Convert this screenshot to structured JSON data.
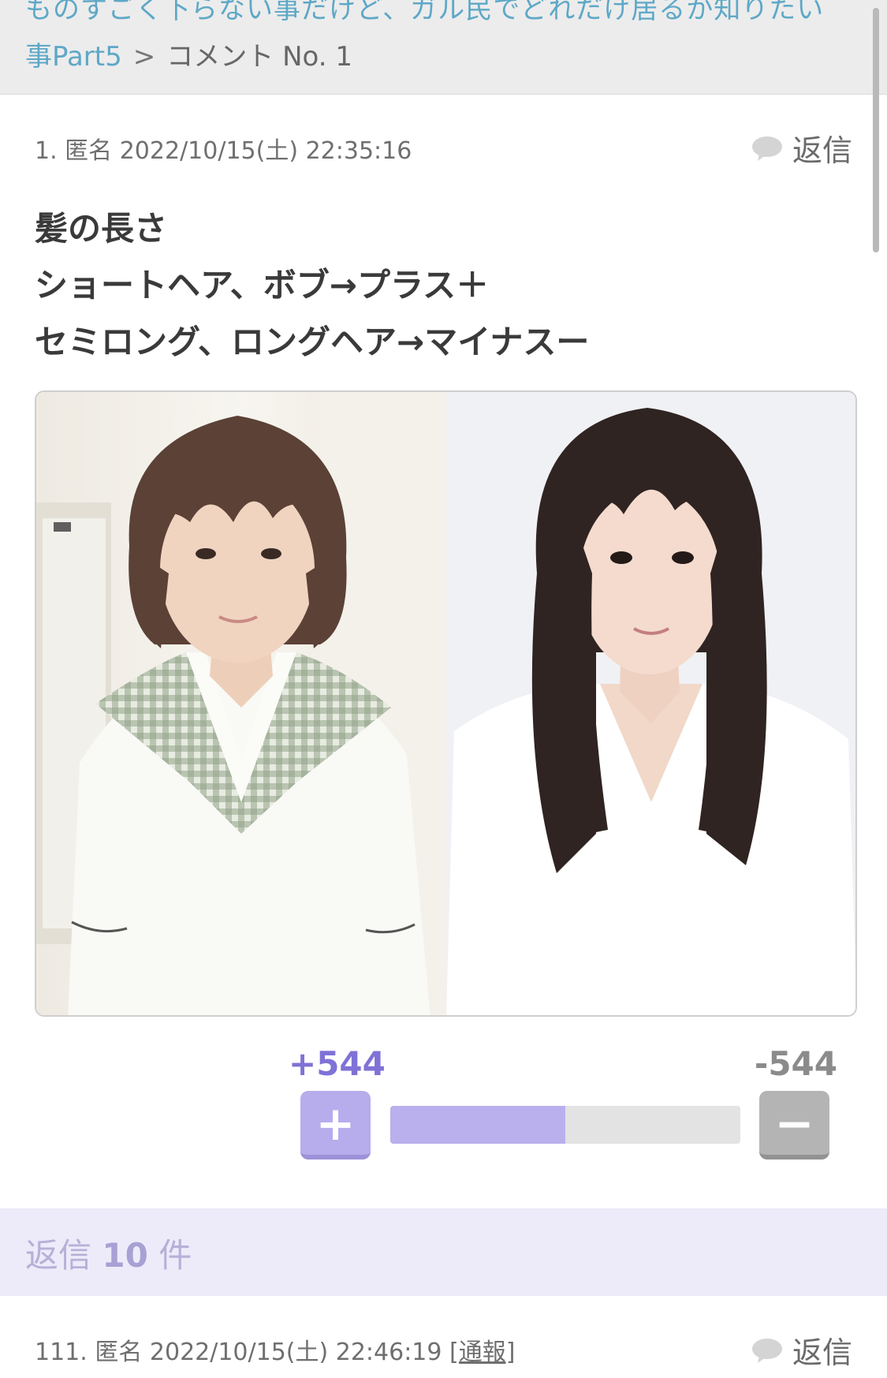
{
  "breadcrumb": {
    "topic_title_line1": "ものすごく下らない事だけど、ガル民でどれだけ居るか知りたい",
    "topic_title_line2": "事Part5",
    "separator": ">",
    "current": "コメント No. 1"
  },
  "comment": {
    "number": "1.",
    "author": "匿名",
    "datetime": "2022/10/15(土) 22:35:16",
    "reply_label": "返信",
    "body_lines": [
      "髪の長さ",
      "ショートヘア、ボブ→プラス＋",
      "セミロング、ロングヘア→マイナスー"
    ],
    "image": {
      "left_description_icon": "short-bob-hair-photo",
      "right_description_icon": "long-hair-photo"
    },
    "votes": {
      "plus_count": "+544",
      "minus_count": "-544",
      "plus_button": "+",
      "minus_button": "−",
      "plus_ratio": 0.5
    }
  },
  "replies": {
    "prefix": "返信",
    "count": "10",
    "suffix": "件"
  },
  "comment2": {
    "number": "111.",
    "author": "匿名",
    "datetime": "2022/10/15(土) 22:46:19",
    "report_label": "[通報]",
    "reply_label": "返信"
  },
  "colors": {
    "link": "#5ea8c7",
    "plus_accent": "#7f72d6",
    "plus_fill": "#b9b0ed",
    "minus_gray": "#b4b4b4",
    "replies_bg": "#edebf9"
  }
}
